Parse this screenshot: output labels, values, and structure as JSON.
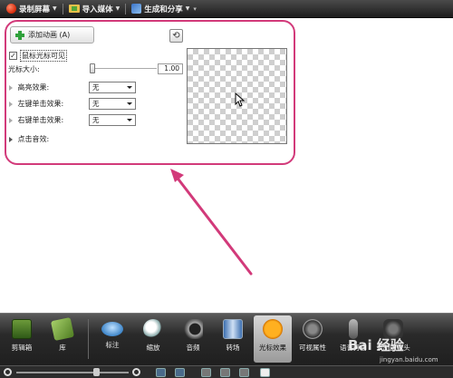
{
  "toolbar": {
    "record_label": "录制屏幕",
    "import_label": "导入媒体",
    "produce_label": "生成和分享"
  },
  "panel": {
    "add_animation_label": "添加动画 (A)",
    "cursor_visible_label": "鼠标光标可见",
    "cursor_visible_checked": true,
    "cursor_size_label": "光标大小:",
    "cursor_size_value": "1.00",
    "highlight_label": "高亮效果:",
    "highlight_value": "无",
    "left_click_label": "左键单击效果:",
    "left_click_value": "无",
    "right_click_label": "右键单击效果:",
    "right_click_value": "无",
    "click_sound_label": "点击音效:"
  },
  "dock": {
    "items": [
      {
        "label": "剪辑箱",
        "icon": "clip-bin-icon"
      },
      {
        "label": "库",
        "icon": "library-icon"
      },
      {
        "label": "标注",
        "icon": "callout-icon"
      },
      {
        "label": "缩放",
        "icon": "zoom-icon"
      },
      {
        "label": "音频",
        "icon": "audio-icon"
      },
      {
        "label": "转场",
        "icon": "transition-icon"
      },
      {
        "label": "光标效果",
        "icon": "cursor-effects-icon",
        "active": true
      },
      {
        "label": "可视属性",
        "icon": "visual-properties-icon"
      },
      {
        "label": "语音旁白",
        "icon": "voice-narration-icon"
      },
      {
        "label": "录制摄像头",
        "icon": "record-camera-icon"
      }
    ]
  },
  "watermark": {
    "brand": "Bai 经验",
    "url": "jingyan.baidu.com"
  },
  "colors": {
    "highlight_border": "#d23a7a",
    "toolbar_bg": "#2a2a2a",
    "dock_bg": "#2a2a2a"
  }
}
